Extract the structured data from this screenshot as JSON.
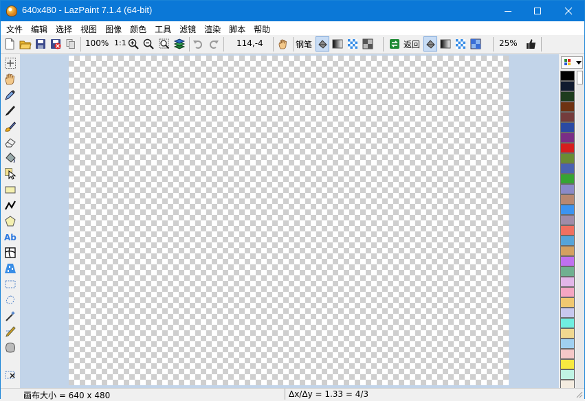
{
  "window": {
    "title": "640x480 - LazPaint 7.1.4 (64-bit)"
  },
  "menu": [
    "文件",
    "编辑",
    "选择",
    "视图",
    "图像",
    "颜色",
    "工具",
    "滤镜",
    "渲染",
    "脚本",
    "帮助"
  ],
  "toolbar": {
    "zoom": "100%",
    "actual_size": "1:1",
    "coordinates": "114,-4",
    "pen_label": "钢笔",
    "back_label": "返回",
    "opacity": "25%"
  },
  "icons": {
    "toolbar": [
      "new-file-icon",
      "open-folder-icon",
      "save-icon",
      "save-as-icon",
      "copy-icon",
      "zoom-in-icon",
      "zoom-out-icon",
      "zoom-fit-icon",
      "layers-icon",
      "undo-icon",
      "redo-icon",
      "hand-icon",
      "pen-fill-icon",
      "gradient-icon",
      "checker-icon",
      "checker-dark-icon",
      "swap-colors-icon",
      "fill-icon",
      "gradient-icon",
      "checker-icon",
      "checker-blue-icon",
      "thumbs-up-icon"
    ],
    "tools": [
      "move-selection-icon",
      "hand-icon",
      "color-picker-icon",
      "pen-icon",
      "brush-icon",
      "eraser-icon",
      "fill-bucket-icon",
      "select-pointer-icon",
      "rectangle-icon",
      "polyline-icon",
      "polygon-icon",
      "text-icon",
      "deform-grid-icon",
      "texture-map-icon",
      "rect-select-icon",
      "lasso-select-icon",
      "magic-wand-icon",
      "select-pen-icon",
      "select-brush-icon",
      "select-erase-icon"
    ]
  },
  "palette": {
    "colors": [
      "#000000",
      "#101a2e",
      "#1e3c1e",
      "#6e3212",
      "#743c3c",
      "#2b4aa3",
      "#7a2e86",
      "#d61e1e",
      "#6a8c34",
      "#4a62b0",
      "#36a432",
      "#8a8ac8",
      "#b88870",
      "#3c94f0",
      "#a08ca8",
      "#f07060",
      "#56a4d8",
      "#d4a060",
      "#c070f0",
      "#70b090",
      "#e2b6e8",
      "#f4a6c2",
      "#f0c870",
      "#c8c8ee",
      "#70eee0",
      "#f0d890",
      "#a0d0f0",
      "#f4c8c8",
      "#f8e840",
      "#c0f4e4",
      "#f4ece0"
    ]
  },
  "status": {
    "canvas_size": "画布大小 = 640 x 480",
    "ratio": "Δx/Δy = 1.33 = 4/3"
  },
  "colors": {
    "titlebar": "#0b78d7",
    "workarea": "#c2d4e9",
    "checker": "#cfcfcf"
  }
}
